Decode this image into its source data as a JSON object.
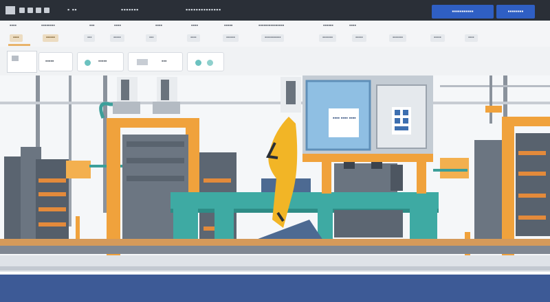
{
  "colors": {
    "top_bar": "#2a2f37",
    "primary_button": "#2f5fc4",
    "frame_orange": "#f0a23c",
    "conveyor_teal": "#3eaaa3",
    "floor_navy": "#3d5a96",
    "robot_yellow": "#f2b526"
  },
  "header": {
    "icons": [
      "app-logo-icon",
      "square-icon",
      "square-icon",
      "square-icon",
      "square-icon"
    ],
    "app_name": "■ ■ ■ ■",
    "section_label": "▪ ▪▪",
    "nav_text_1": "▪▪▪▪▪▪▪",
    "nav_text_2": "▪▪▪▪▪▪▪▪▪▪▪▪▪▪",
    "primary_action_label": "▪▪▪▪▪▪▪▪▪▪▪",
    "secondary_action_label": "▪▪▪▪▪▪▪▪"
  },
  "menu": {
    "items": [
      "▪▪▪▪",
      "▪▪▪▪▪▪▪▪",
      "▪▪▪",
      "▪▪▪▪",
      "▪▪▪▪",
      "▪▪▪▪",
      "▪▪▪▪▪",
      "▪▪▪▪▪▪▪▪▪▪▪▪▪▪▪",
      "▪▪▪▪▪▪",
      "▪▪▪▪"
    ],
    "sub_items": [
      "▪▪▪▪",
      "▪▪▪▪▪▪",
      "▪▪▪",
      "▪▪▪▪▪",
      "▪▪▪",
      "▪▪▪▪",
      "▪▪▪▪▪▪",
      "▪▪▪▪▪▪▪▪▪▪▪",
      "▪▪▪▪▪▪▪",
      "▪▪▪▪▪",
      "▪▪▪▪▪▪▪",
      "▪▪▪▪▪",
      "▪▪▪▪"
    ]
  },
  "toolbar": {
    "card_1_label": "▪▪▪▪▪",
    "card_2_label": "▪▪▪▪▪",
    "card_3_label": "▪▪▪",
    "icons": [
      "image-icon",
      "teal-dot-icon",
      "gray-dot-icon",
      "document-icon",
      "teal-dot-icon",
      "teal-dot-icon"
    ]
  },
  "scene": {
    "panel_text": "▪▪▪▪ ▪▪▪▪ ▪▪▪▪",
    "subject": "factory-production-line-illustration"
  }
}
